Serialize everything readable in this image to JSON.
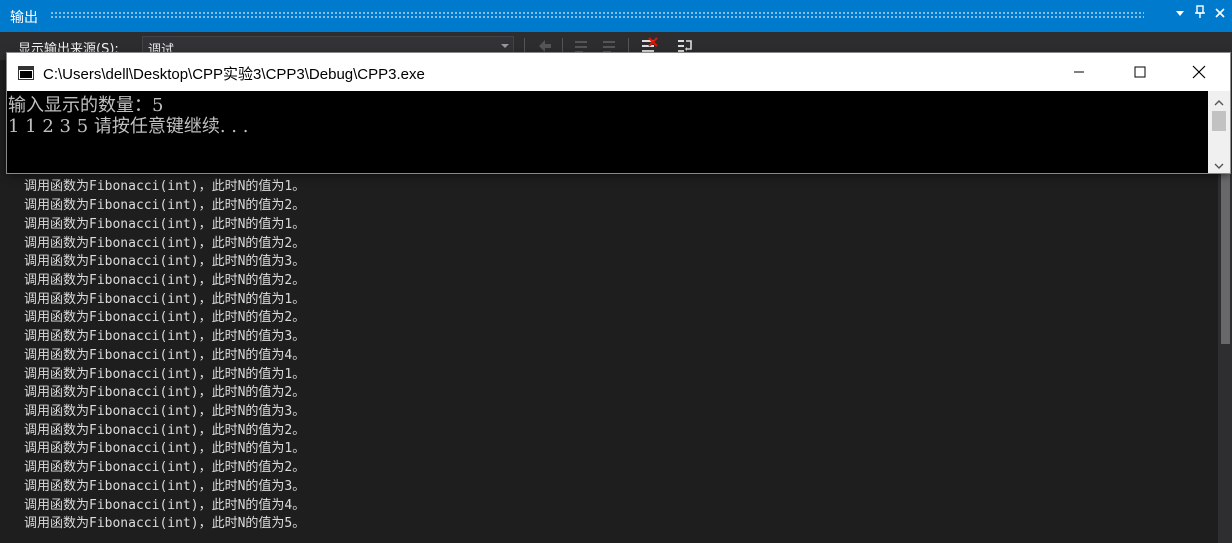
{
  "output_panel": {
    "title": "输出",
    "pin_glyph": "▾",
    "pin2_glyph": "📌",
    "close_glyph": "✕",
    "source_label": "显示输出来源(S):",
    "source_value": "调试",
    "lines": [
      "调用函数为Fibonacci(int)，此时N的值为1。",
      "调用函数为Fibonacci(int)，此时N的值为2。",
      "调用函数为Fibonacci(int)，此时N的值为1。",
      "调用函数为Fibonacci(int)，此时N的值为2。",
      "调用函数为Fibonacci(int)，此时N的值为3。",
      "调用函数为Fibonacci(int)，此时N的值为2。",
      "调用函数为Fibonacci(int)，此时N的值为1。",
      "调用函数为Fibonacci(int)，此时N的值为2。",
      "调用函数为Fibonacci(int)，此时N的值为3。",
      "调用函数为Fibonacci(int)，此时N的值为4。",
      "调用函数为Fibonacci(int)，此时N的值为1。",
      "调用函数为Fibonacci(int)，此时N的值为2。",
      "调用函数为Fibonacci(int)，此时N的值为3。",
      "调用函数为Fibonacci(int)，此时N的值为2。",
      "调用函数为Fibonacci(int)，此时N的值为1。",
      "调用函数为Fibonacci(int)，此时N的值为2。",
      "调用函数为Fibonacci(int)，此时N的值为3。",
      "调用函数为Fibonacci(int)，此时N的值为4。",
      "调用函数为Fibonacci(int)，此时N的值为5。"
    ]
  },
  "console": {
    "title": "C:\\Users\\dell\\Desktop\\CPP实验3\\CPP3\\Debug\\CPP3.exe",
    "lines": [
      "输入显示的数量：5",
      "1 1 2 3 5 请按任意键继续. . ."
    ]
  },
  "colors": {
    "accent": "#007acc",
    "panel_bg": "#1e1e1e",
    "console_bg": "#000000"
  }
}
